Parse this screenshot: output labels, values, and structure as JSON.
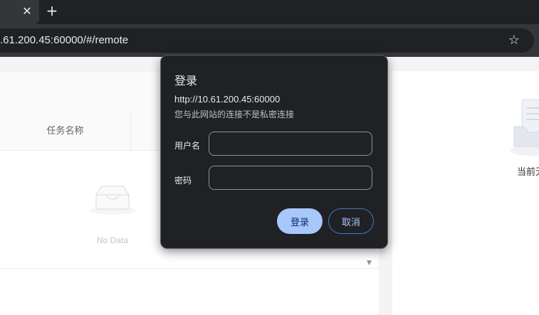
{
  "browser": {
    "tab_close_glyph": "✕",
    "new_tab_glyph": "+",
    "url": ".61.200.45:60000/#/remote",
    "bookmark_glyph": "☆"
  },
  "table": {
    "column_title": "任务名称",
    "empty_text": "No Data"
  },
  "right_panel": {
    "empty_text": "当前无"
  },
  "dialog": {
    "title": "登录",
    "host": "http://10.61.200.45:60000",
    "warning": "您与此网站的连接不是私密连接",
    "username_label": "用户名",
    "password_label": "密码",
    "username_value": "",
    "password_value": "",
    "ok_label": "登录",
    "cancel_label": "取消"
  },
  "colors": {
    "tabstrip": "#202124",
    "toolbar": "#35363a",
    "dialog_bg": "#202124",
    "primary_button": "#a8c7fa",
    "outline_button": "#3e7bbf"
  }
}
